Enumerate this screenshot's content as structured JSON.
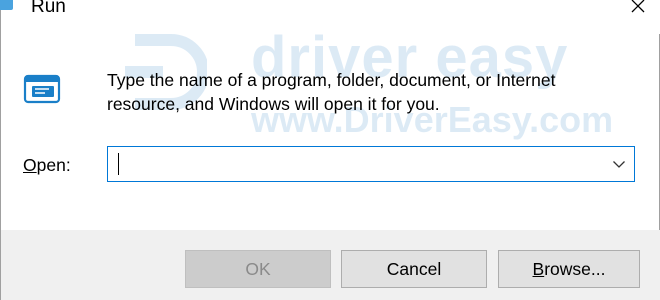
{
  "window": {
    "title": "Run",
    "close_icon": "close-icon",
    "title_icon": "run-app-icon"
  },
  "watermark": {
    "brand": "driver easy",
    "url": "www.DriverEasy.com"
  },
  "main": {
    "icon": "run-icon",
    "description": "Type the name of a program, folder, document, or Internet resource, and Windows will open it for you.",
    "open_label_prefix": "",
    "open_label_underlined": "O",
    "open_label_rest": "pen:",
    "open_value": "",
    "dropdown_icon": "chevron-down-icon"
  },
  "buttons": {
    "ok_label": "OK",
    "cancel_label": "Cancel",
    "browse_underlined": "B",
    "browse_rest": "rowse..."
  },
  "colors": {
    "accent": "#0078d7",
    "watermark": "#2d83c8",
    "footer_bg": "#f0f0f0",
    "button_bg": "#e1e1e1",
    "disabled_button_bg": "#cccccc"
  }
}
